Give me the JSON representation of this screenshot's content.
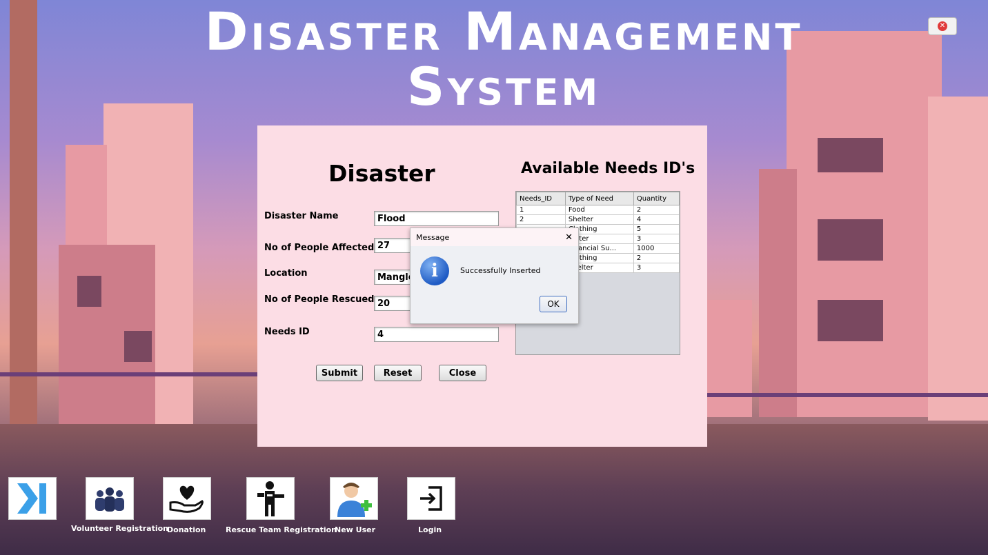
{
  "app": {
    "title": "Disaster Management System"
  },
  "form": {
    "heading": "Disaster",
    "fields": [
      {
        "label": "Disaster Name",
        "value": "Flood"
      },
      {
        "label": "No of People Affected",
        "value": "27"
      },
      {
        "label": "Location",
        "value": "Manglo"
      },
      {
        "label": "No of People Rescued",
        "value": "20"
      },
      {
        "label": "Needs ID",
        "value": "4"
      }
    ],
    "buttons": {
      "submit": "Submit",
      "reset": "Reset",
      "close": "Close"
    }
  },
  "needs": {
    "heading": "Available Needs ID's",
    "columns": [
      "Needs_ID",
      "Type of Need",
      "Quantity"
    ],
    "rows": [
      [
        "1",
        "Food",
        "2"
      ],
      [
        "2",
        "Shelter",
        "4"
      ],
      [
        "",
        "Clothing",
        "5"
      ],
      [
        "",
        "Water",
        "3"
      ],
      [
        "",
        "Financial Su...",
        "1000"
      ],
      [
        "",
        "Clothing",
        "2"
      ],
      [
        "",
        "Shelter",
        "3"
      ]
    ]
  },
  "dialog": {
    "title": "Message",
    "close_glyph": "✕",
    "icon": "info-icon",
    "message": "Successfully Inserted",
    "ok": "OK"
  },
  "dock": [
    {
      "label": "",
      "icon": "skip-forward-icon"
    },
    {
      "label": "Volunteer Registration",
      "icon": "group-icon"
    },
    {
      "label": "Donation",
      "icon": "heart-hand-icon"
    },
    {
      "label": "Rescue Team Registration",
      "icon": "rescuer-icon"
    },
    {
      "label": "New User",
      "icon": "add-user-icon"
    },
    {
      "label": "Login",
      "icon": "login-icon"
    }
  ],
  "colors": {
    "panel": "#fcdde5",
    "dock_arrow": "#3ba0e8"
  }
}
